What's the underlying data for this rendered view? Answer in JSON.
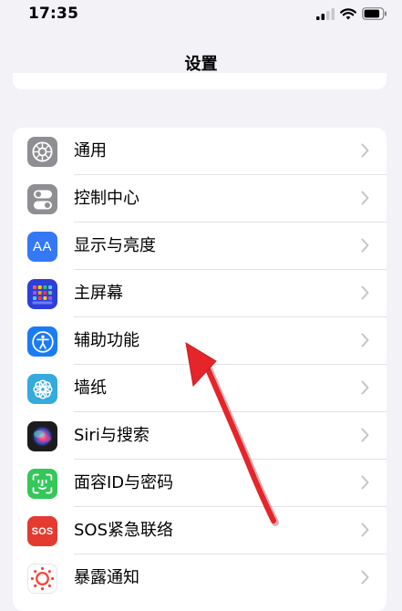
{
  "status": {
    "time": "17:35"
  },
  "header": {
    "title": "设置"
  },
  "settings": [
    {
      "label": "通用",
      "icon": "gear-icon",
      "color": "#8e8e93"
    },
    {
      "label": "控制中心",
      "icon": "toggles-icon",
      "color": "#8e8e93"
    },
    {
      "label": "显示与亮度",
      "icon": "text-size-icon",
      "color": "#3478f6"
    },
    {
      "label": "主屏幕",
      "icon": "app-grid-icon",
      "color": "#2d3fd8"
    },
    {
      "label": "辅助功能",
      "icon": "accessibility-icon",
      "color": "#1a7cf5"
    },
    {
      "label": "墙纸",
      "icon": "flower-icon",
      "color": "#35aadc"
    },
    {
      "label": "Siri与搜索",
      "icon": "siri-icon",
      "color": "#1c1c1e"
    },
    {
      "label": "面容ID与密码",
      "icon": "face-id-icon",
      "color": "#34c759"
    },
    {
      "label": "SOS紧急联络",
      "icon": "sos-icon",
      "color": "#e33b30"
    },
    {
      "label": "暴露通知",
      "icon": "exposure-icon",
      "color": "#ffffff"
    }
  ],
  "icon_text": {
    "display": "AA",
    "sos": "SOS"
  },
  "annotation": {
    "arrow_color": "#e4252a"
  }
}
